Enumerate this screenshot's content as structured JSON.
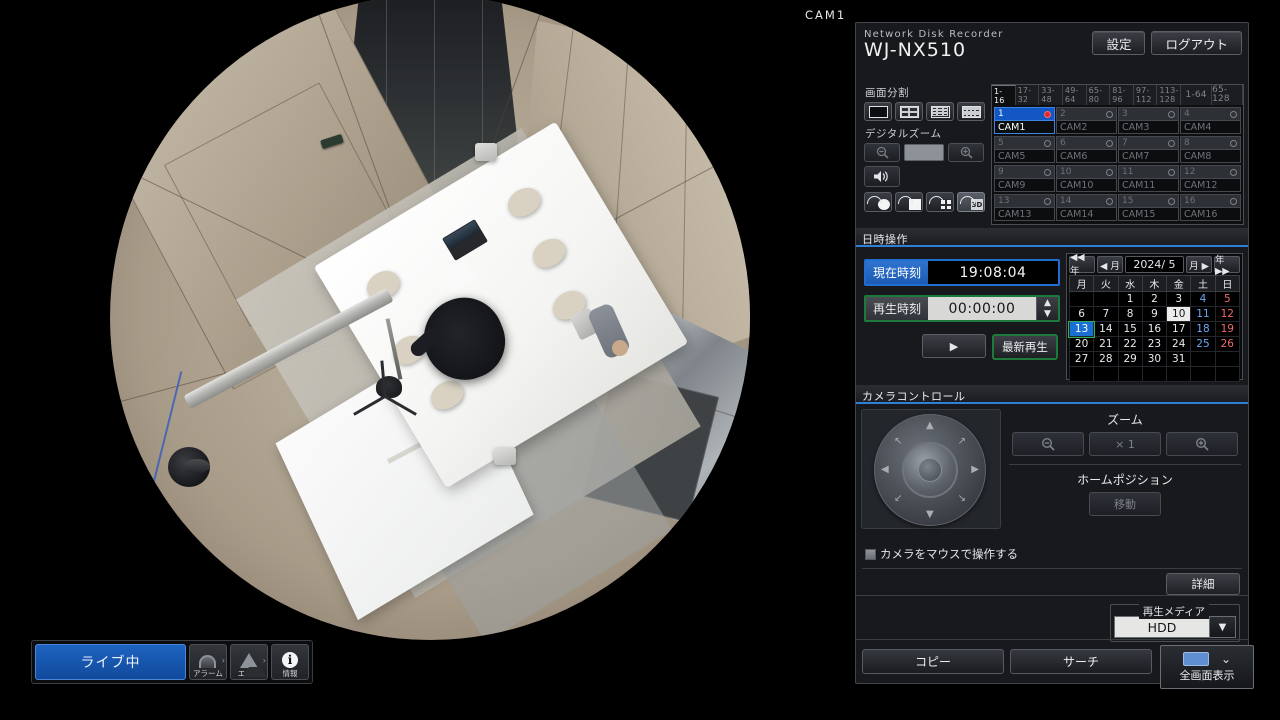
{
  "video": {
    "camera_label": "CAM1",
    "scene": "fisheye overhead view of an office meeting room"
  },
  "statusbar": {
    "live_label": "ライブ中",
    "alarm_label": "アラーム",
    "error_label": "エラー",
    "info_label": "情報",
    "chevron": "›"
  },
  "header": {
    "product_line": "Network Disk Recorder",
    "model": "WJ-NX510",
    "settings_label": "設定",
    "logout_label": "ログアウト"
  },
  "screen_division": {
    "title": "画面分割",
    "options": [
      "1",
      "4",
      "9",
      "16"
    ]
  },
  "digital_zoom": {
    "title": "デジタルズーム",
    "zoom_out": "−",
    "zoom_in": "+",
    "speaker_icon": "speaker-icon",
    "fisheye_modes": [
      "fisheye-circle",
      "fisheye-panorama",
      "fisheye-quad",
      "fisheye-3d"
    ],
    "active_fisheye_mode": 3
  },
  "camera_select": {
    "tabs": [
      "1-\n16",
      "17-\n32",
      "33-\n48",
      "49-\n64",
      "65-\n80",
      "81-\n96",
      "97-\n112",
      "113-\n128"
    ],
    "tabs_top": [
      "1-",
      "17-",
      "33-",
      "49-",
      "65-",
      "81-",
      "97-",
      "113-"
    ],
    "tabs_bottom": [
      "16",
      "32",
      "48",
      "64",
      "80",
      "96",
      "112",
      "128"
    ],
    "range_tabs": [
      "1-64",
      "65-128"
    ],
    "active_tab": 0,
    "cameras": [
      {
        "num": "1",
        "name": "CAM1",
        "recording": true
      },
      {
        "num": "2",
        "name": "CAM2",
        "recording": false
      },
      {
        "num": "3",
        "name": "CAM3",
        "recording": false
      },
      {
        "num": "4",
        "name": "CAM4",
        "recording": false
      },
      {
        "num": "5",
        "name": "CAM5",
        "recording": false
      },
      {
        "num": "6",
        "name": "CAM6",
        "recording": false
      },
      {
        "num": "7",
        "name": "CAM7",
        "recording": false
      },
      {
        "num": "8",
        "name": "CAM8",
        "recording": false
      },
      {
        "num": "9",
        "name": "CAM9",
        "recording": false
      },
      {
        "num": "10",
        "name": "CAM10",
        "recording": false
      },
      {
        "num": "11",
        "name": "CAM11",
        "recording": false
      },
      {
        "num": "12",
        "name": "CAM12",
        "recording": false
      },
      {
        "num": "13",
        "name": "CAM13",
        "recording": false
      },
      {
        "num": "14",
        "name": "CAM14",
        "recording": false
      },
      {
        "num": "15",
        "name": "CAM15",
        "recording": false
      },
      {
        "num": "16",
        "name": "CAM16",
        "recording": false
      }
    ],
    "active_camera": 0
  },
  "datetime": {
    "title": "日時操作",
    "current_time_label": "現在時刻",
    "current_time_value": "19:08:04",
    "play_time_label": "再生時刻",
    "play_time_value": "00:00:00",
    "spin_up": "▲",
    "spin_down": "▼",
    "play_button": "▶",
    "latest_play_label": "最新再生"
  },
  "calendar": {
    "prev_year": "◀◀ 年",
    "prev_month": "◀ 月",
    "year_month": "2024/ 5",
    "next_month": "月 ▶",
    "next_year": "年 ▶▶",
    "weekdays": [
      "月",
      "火",
      "水",
      "木",
      "金",
      "土",
      "日"
    ],
    "weeks": [
      [
        "",
        "",
        "1",
        "2",
        "3",
        "4",
        "5"
      ],
      [
        "6",
        "7",
        "8",
        "9",
        "10",
        "11",
        "12"
      ],
      [
        "13",
        "14",
        "15",
        "16",
        "17",
        "18",
        "19"
      ],
      [
        "20",
        "21",
        "22",
        "23",
        "24",
        "25",
        "26"
      ],
      [
        "27",
        "28",
        "29",
        "30",
        "31",
        "",
        ""
      ],
      [
        "",
        "",
        "",
        "",
        "",
        "",
        ""
      ]
    ],
    "selected_day": "13",
    "recorded_day": "10"
  },
  "camera_control": {
    "title": "カメラコントロール",
    "pad_name": "pan-tilt-pad",
    "zoom_title": "ズーム",
    "zoom_out": "−",
    "zoom_level": "× 1",
    "zoom_in": "+",
    "home_title": "ホームポジション",
    "home_move": "移動",
    "mouse_checkbox_label": "カメラをマウスで操作する",
    "mouse_checkbox_checked": false,
    "detail_label": "詳細"
  },
  "media": {
    "title": "再生メディア",
    "selected": "HDD",
    "dropdown_icon": "chevron-down-icon"
  },
  "bottom": {
    "copy_label": "コピー",
    "search_label": "サーチ",
    "fullscreen_label": "全画面表示",
    "fullscreen_chevron": "chevron-down-icon"
  }
}
